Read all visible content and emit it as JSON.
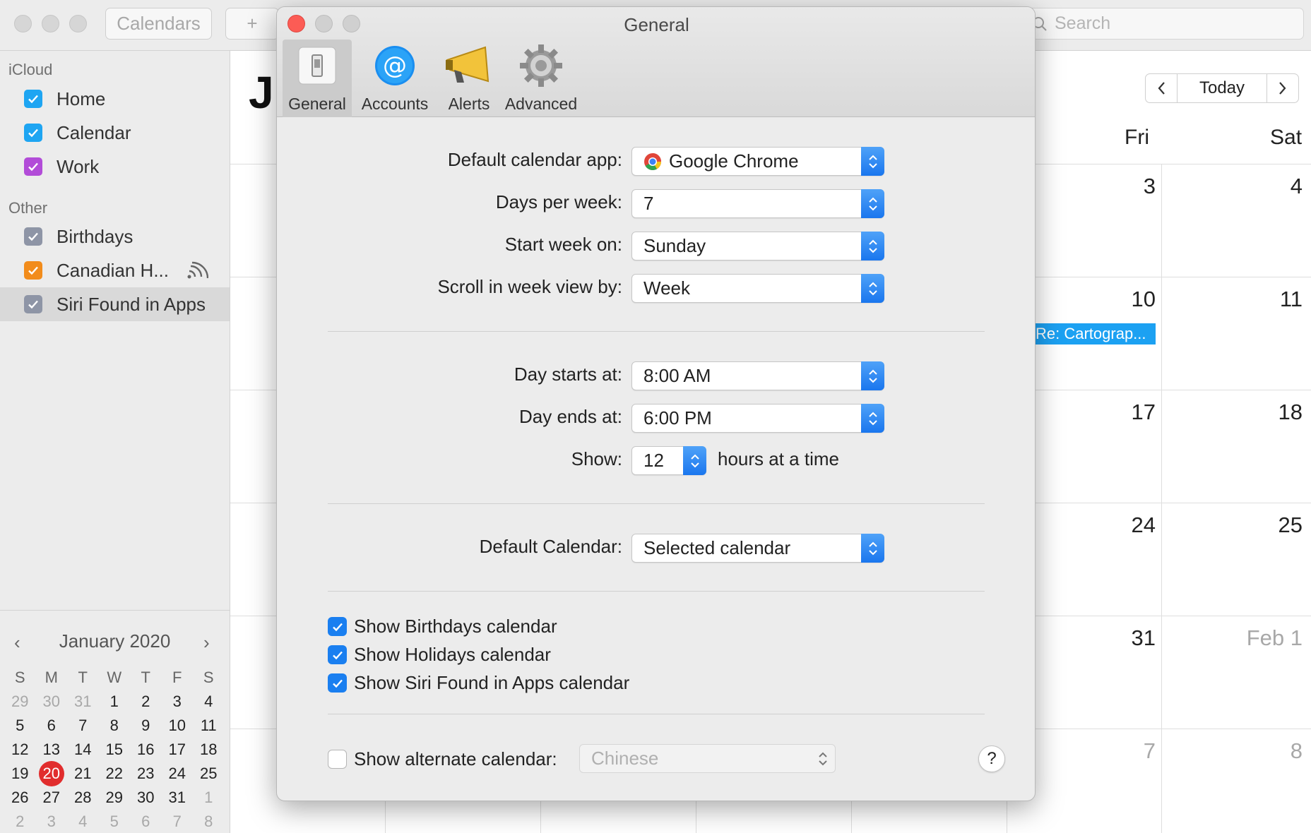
{
  "toolbar": {
    "calendars_label": "Calendars",
    "add_label": "+",
    "search_placeholder": "Search"
  },
  "sidebar": {
    "icloud_header": "iCloud",
    "icloud_items": [
      {
        "label": "Home",
        "color": "#1ea5f2"
      },
      {
        "label": "Calendar",
        "color": "#1ea5f2"
      },
      {
        "label": "Work",
        "color": "#b24cd8"
      }
    ],
    "other_header": "Other",
    "other_items": [
      {
        "label": "Birthdays",
        "color": "#8e95a6"
      },
      {
        "label": "Canadian H...",
        "color": "#f28c1b"
      },
      {
        "label": "Siri Found in Apps",
        "color": "#8e95a6"
      }
    ]
  },
  "mini_calendar": {
    "title": "January 2020",
    "prev": "‹",
    "next": "›",
    "weekday_headers": [
      "S",
      "M",
      "T",
      "W",
      "T",
      "F",
      "S"
    ],
    "weeks": [
      [
        "29",
        "30",
        "31",
        "1",
        "2",
        "3",
        "4"
      ],
      [
        "5",
        "6",
        "7",
        "8",
        "9",
        "10",
        "11"
      ],
      [
        "12",
        "13",
        "14",
        "15",
        "16",
        "17",
        "18"
      ],
      [
        "19",
        "20",
        "21",
        "22",
        "23",
        "24",
        "25"
      ],
      [
        "26",
        "27",
        "28",
        "29",
        "30",
        "31",
        "1"
      ],
      [
        "2",
        "3",
        "4",
        "5",
        "6",
        "7",
        "8"
      ]
    ],
    "today": "20"
  },
  "main_calendar": {
    "month_initial": "J",
    "today_button": "Today",
    "day_headers": [
      "Fri",
      "Sat"
    ],
    "fri_dates": [
      "3",
      "10",
      "17",
      "24",
      "31",
      "7"
    ],
    "sat_dates": [
      "4",
      "11",
      "18",
      "25",
      "Feb 1",
      "8"
    ],
    "event_label": "Re: Cartograp..."
  },
  "dialog": {
    "title": "General",
    "tabs": [
      "General",
      "Accounts",
      "Alerts",
      "Advanced"
    ],
    "active_tab": "General",
    "accent": "#1a7ff0",
    "default_app_label": "Default calendar app:",
    "default_app_value": "Google Chrome",
    "days_per_week_label": "Days per week:",
    "days_per_week_value": "7",
    "start_week_label": "Start week on:",
    "start_week_value": "Sunday",
    "scroll_label": "Scroll in week view by:",
    "scroll_value": "Week",
    "day_starts_label": "Day starts at:",
    "day_starts_value": "8:00 AM",
    "day_ends_label": "Day ends at:",
    "day_ends_value": "6:00 PM",
    "show_label": "Show:",
    "show_value": "12",
    "show_suffix": "hours at a time",
    "default_calendar_label": "Default Calendar:",
    "default_calendar_value": "Selected calendar",
    "show_birthdays": "Show Birthdays calendar",
    "show_holidays": "Show Holidays calendar",
    "show_siri": "Show Siri Found in Apps calendar",
    "show_alternate": "Show alternate calendar:",
    "alternate_value": "Chinese",
    "help": "?"
  }
}
